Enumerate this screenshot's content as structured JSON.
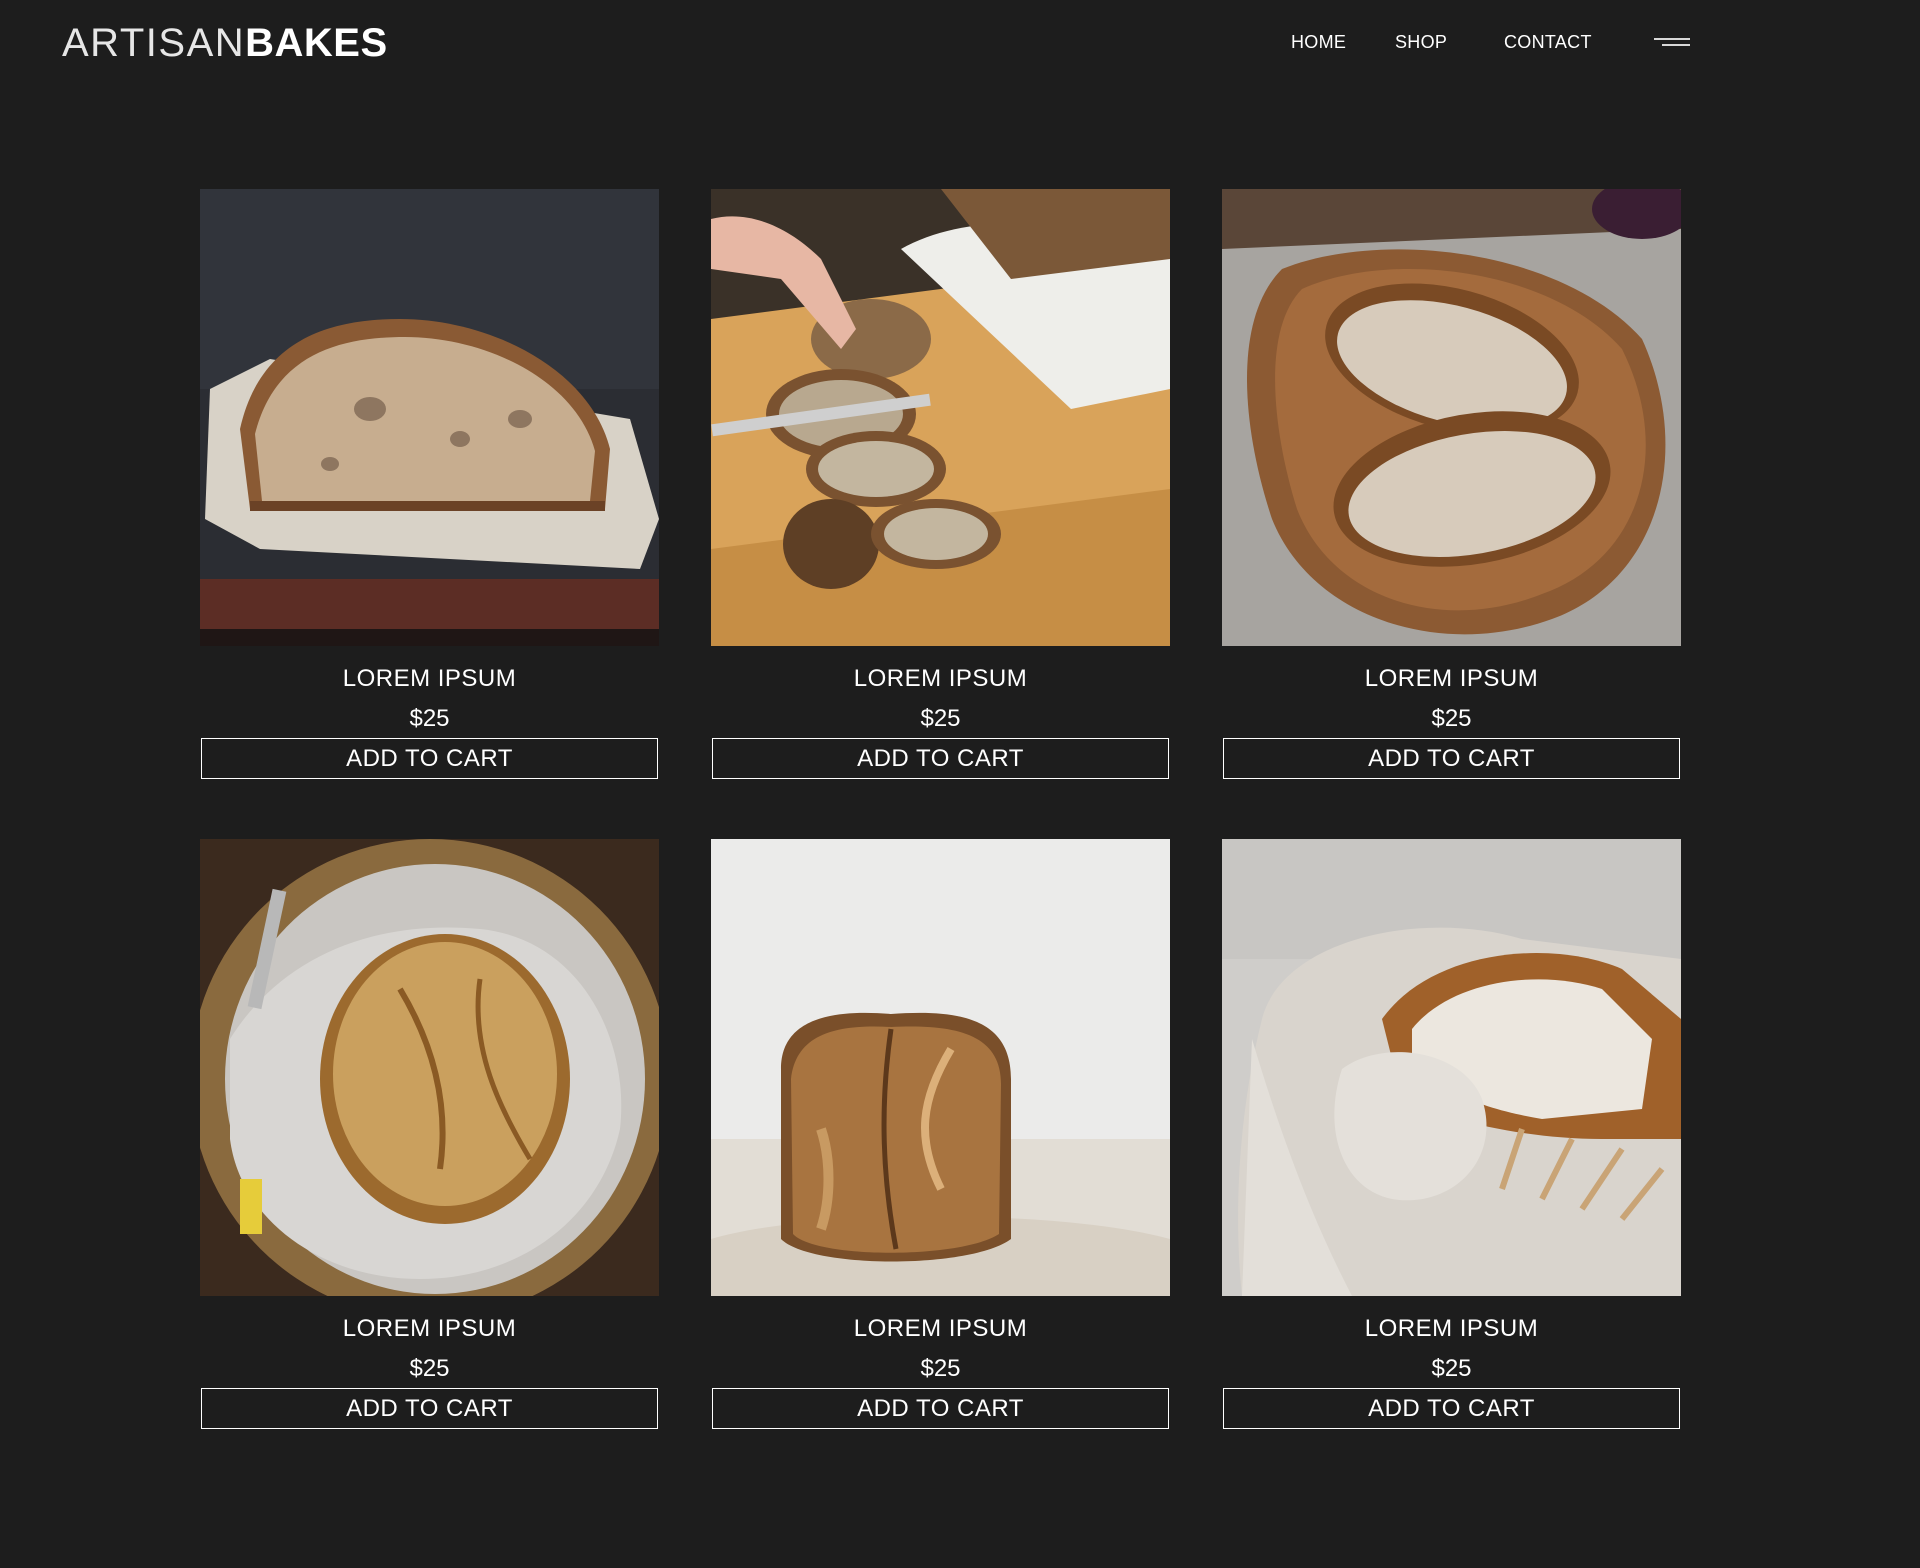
{
  "brand": {
    "name_light": "ARTISAN",
    "name_bold": "BAKES"
  },
  "nav": {
    "items": [
      {
        "label": "HOME"
      },
      {
        "label": "SHOP"
      },
      {
        "label": "CONTACT"
      }
    ],
    "menu_icon": "hamburger-icon"
  },
  "colors": {
    "background": "#1d1d1d",
    "text": "#ffffff",
    "button_border": "#ffffff"
  },
  "products": [
    {
      "title": "LOREM IPSUM",
      "price": "$25",
      "button": "ADD TO CART",
      "image": "sourdough-half-loaf-on-parchment"
    },
    {
      "title": "LOREM IPSUM",
      "price": "$25",
      "button": "ADD TO CART",
      "image": "sliced-seeded-bread-on-board"
    },
    {
      "title": "LOREM IPSUM",
      "price": "$25",
      "button": "ADD TO CART",
      "image": "sliced-sourdough-on-wooden-plate"
    },
    {
      "title": "LOREM IPSUM",
      "price": "$25",
      "button": "ADD TO CART",
      "image": "boule-in-wicker-basket"
    },
    {
      "title": "LOREM IPSUM",
      "price": "$25",
      "button": "ADD TO CART",
      "image": "tall-loaf-on-linen"
    },
    {
      "title": "LOREM IPSUM",
      "price": "$25",
      "button": "ADD TO CART",
      "image": "bread-wrapped-in-linen"
    }
  ]
}
